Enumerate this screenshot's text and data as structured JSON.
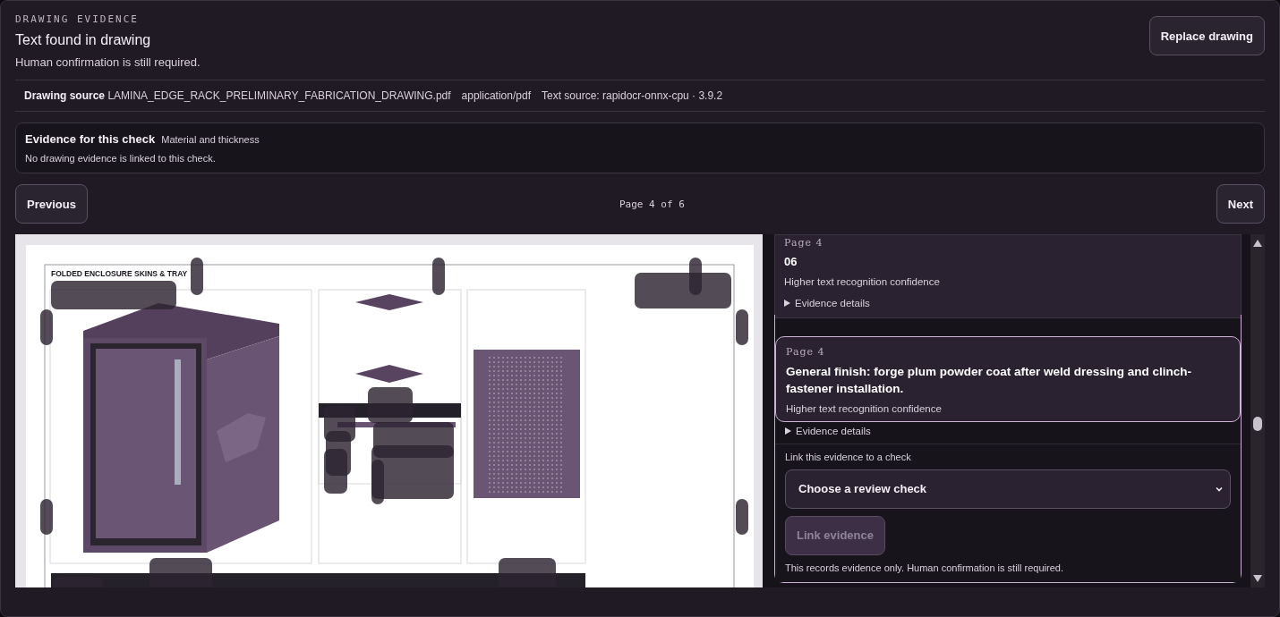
{
  "header": {
    "eyebrow": "DRAWING EVIDENCE",
    "title": "Text found in drawing",
    "subtitle": "Human confirmation is still required.",
    "action": "Replace drawing"
  },
  "source": {
    "label": "Drawing source",
    "file": "LAMINA_EDGE_RACK_PRELIMINARY_FABRICATION_DRAWING.pdf",
    "mime": "application/pdf",
    "engine": "Text source: rapidocr-onnx-cpu · 3.9.2"
  },
  "check": {
    "label": "Evidence for this check",
    "name": "Material and thickness",
    "message": "No drawing evidence is linked to this check."
  },
  "pager": {
    "previous": "Previous",
    "status": "Page 4 of 6",
    "next": "Next"
  },
  "drawing": {
    "title": "FOLDED ENCLOSURE SKINS & TRAY"
  },
  "evidence": [
    {
      "page": "Page 4",
      "text": "06",
      "confidence": "Higher text recognition confidence",
      "details": "Evidence details",
      "selected": false
    },
    {
      "page": "Page 4",
      "text": "General finish: forge plum powder coat after weld dressing and clinch-fastener installation.",
      "confidence": "Higher text recognition confidence",
      "details": "Evidence details",
      "selected": true
    }
  ],
  "link_form": {
    "label": "Link this evidence to a check",
    "select": {
      "placeholder": "Choose a review check"
    },
    "button": {
      "label": "Link evidence",
      "disabled": true
    },
    "note": "This records evidence only. Human confirmation is still required."
  }
}
